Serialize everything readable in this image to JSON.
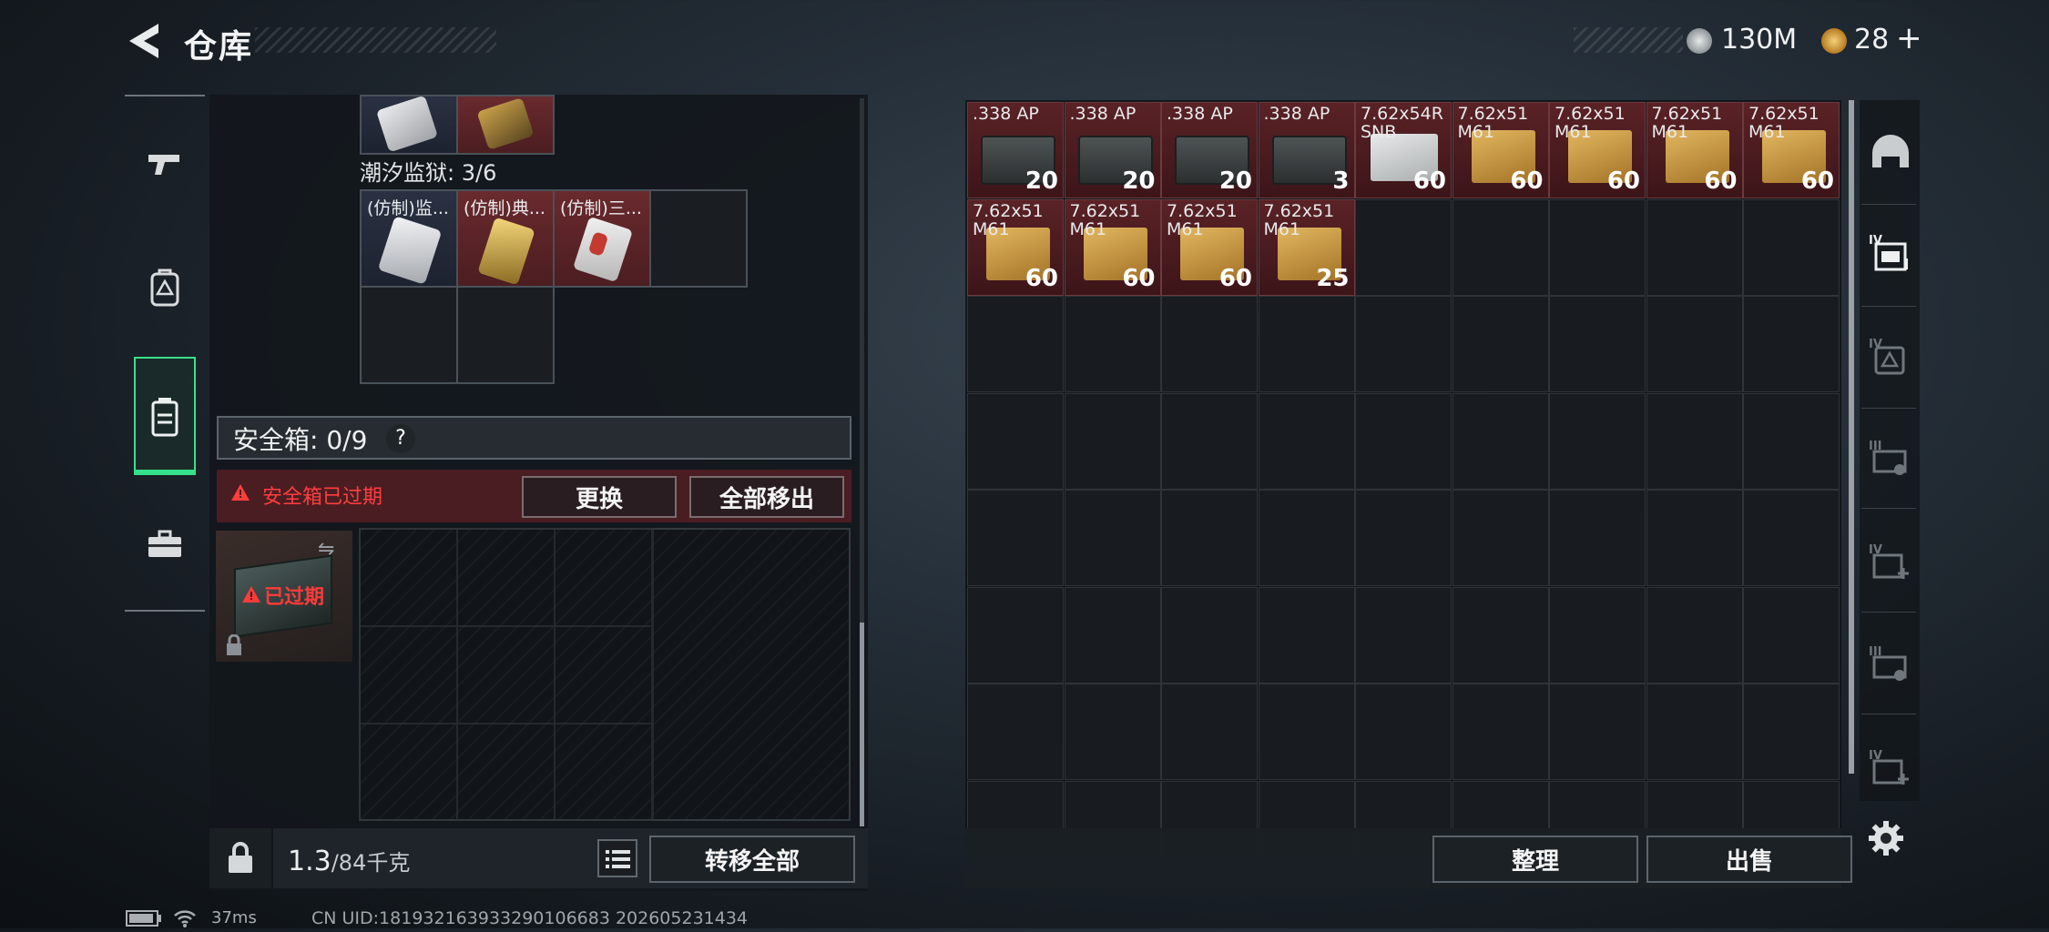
{
  "header": {
    "title": "仓库",
    "currency1": "130M",
    "currency2": "28",
    "add_symbol": "+",
    "colors": {
      "coin1": "#b9c0c5",
      "coin2": "#d9a441"
    }
  },
  "nav": {
    "items": [
      "gun-icon",
      "backpack-icon",
      "chest-rig-icon",
      "case-icon"
    ],
    "active_index": 2,
    "active_color": "#3be08b"
  },
  "left": {
    "prison_label": "潮汐监狱: 3/6",
    "cards": [
      "(仿制)监...",
      "(仿制)典...",
      "(仿制)三..."
    ],
    "safebox_label": "安全箱: 0/9",
    "help": "?",
    "expired_warning": "安全箱已过期",
    "replace_button": "更换",
    "remove_all_button": "全部移出",
    "expired_overlay": "已过期",
    "weight_value": "1.3",
    "weight_max": "/84千克",
    "transfer_all_button": "转移全部"
  },
  "inventory": {
    "items": [
      {
        "name": ".338 AP",
        "qty": "20",
        "kind": "dark"
      },
      {
        "name": ".338 AP",
        "qty": "20",
        "kind": "dark"
      },
      {
        "name": ".338 AP",
        "qty": "20",
        "kind": "dark"
      },
      {
        "name": ".338 AP",
        "qty": "3",
        "kind": "dark"
      },
      {
        "name": "7.62x54R SNB",
        "qty": "60",
        "kind": "white"
      },
      {
        "name": "7.62x51 M61",
        "qty": "60",
        "kind": "tan"
      },
      {
        "name": "7.62x51 M61",
        "qty": "60",
        "kind": "tan"
      },
      {
        "name": "7.62x51 M61",
        "qty": "60",
        "kind": "tan"
      },
      {
        "name": "7.62x51 M61",
        "qty": "60",
        "kind": "tan"
      },
      {
        "name": "7.62x51 M61",
        "qty": "60",
        "kind": "tan"
      },
      {
        "name": "7.62x51 M61",
        "qty": "60",
        "kind": "tan"
      },
      {
        "name": "7.62x51 M61",
        "qty": "60",
        "kind": "tan"
      },
      {
        "name": "7.62x51 M61",
        "qty": "25",
        "kind": "tan"
      }
    ],
    "sort_button": "整理",
    "sell_button": "出售"
  },
  "side_icons": [
    "helmet-icon",
    "iv-vest-icon",
    "iv-backpack-icon",
    "iii-dsa-icon",
    "iv-medkit-icon",
    "iii-dsa-icon",
    "iv-medkit-icon",
    "settings-icon"
  ],
  "status": {
    "ping": "37ms",
    "uid": "CN UID:181932163933290106683 202605231434"
  }
}
